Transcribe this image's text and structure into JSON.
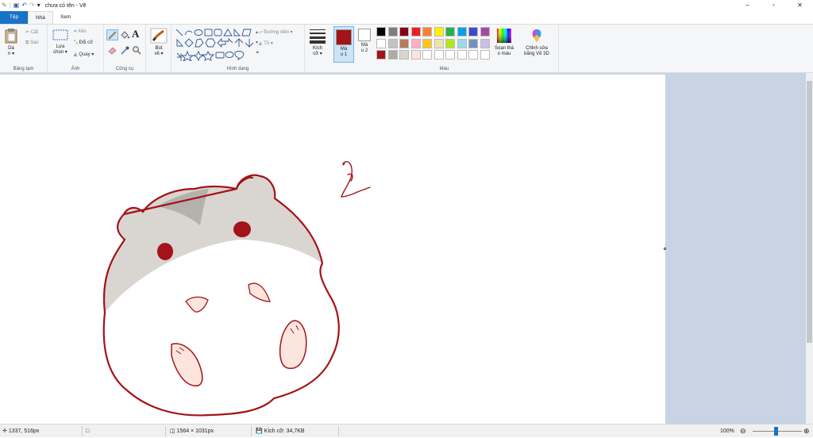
{
  "window": {
    "title": "chưa có tên - Vẽ",
    "buttons": {
      "minimize": "–",
      "maximize": "▫",
      "close": "✕"
    }
  },
  "quick_access": {
    "dropdown": "▾"
  },
  "tabs": [
    {
      "label": "Tệp"
    },
    {
      "label": "Nhà"
    },
    {
      "label": "Xem"
    }
  ],
  "ribbon": {
    "clipboard": {
      "paste_label": "Dá",
      "paste_sub": "n ▾",
      "cut": "Cắt",
      "copy": "Sao",
      "group": "Bảng tạm"
    },
    "image": {
      "select_label": "Lựa",
      "select_sub": "chọn ▾",
      "crop": "Xén",
      "resize": "Đổi cỡ",
      "rotate": "Quay ▾",
      "group": "Ảnh"
    },
    "tools": {
      "group": "Công cụ",
      "text_glyph": "A"
    },
    "brushes": {
      "label": "Bút",
      "sub": "vẽ ▾"
    },
    "shapes": {
      "outline": "Đường viền ▾",
      "fill": "Tô ▾",
      "group": "Hình dạng"
    },
    "size": {
      "label": "Kích",
      "sub": "cỡ ▾"
    },
    "color1": {
      "label": "Mà",
      "sub": "u 1",
      "value": "#a31319"
    },
    "color2": {
      "label": "Mà",
      "sub": "u 2",
      "value": "#ffffff"
    },
    "colors": {
      "group": "Màu",
      "row1": [
        "#000000",
        "#7f7f7f",
        "#880015",
        "#ed1c24",
        "#ff7f27",
        "#fff200",
        "#22b14c",
        "#00a2e8",
        "#3f48cc",
        "#a349a4"
      ],
      "row2": [
        "#ffffff",
        "#c3c3c3",
        "#b97a57",
        "#ffaec9",
        "#ffc90e",
        "#efe4b0",
        "#b5e61d",
        "#99d9ea",
        "#7092be",
        "#c8bfe7"
      ],
      "row3": [
        "#a31319",
        "#aeaaa6",
        "#d9d5d0",
        "#fbe5dc",
        "#ffffff",
        "#ffffff",
        "#ffffff",
        "#ffffff",
        "#ffffff",
        "#ffffff"
      ],
      "edit_label": "Soạn thả",
      "edit_sub": "o màu",
      "paint3d_label": "Chỉnh sửa",
      "paint3d_sub": "bằng Vẽ 3D"
    }
  },
  "drawing": {
    "outline_color": "#a31319",
    "fur_color": "#d9d5d0",
    "shade_color": "#b5b1ac",
    "eye_color": "#a31319",
    "paw_color": "#fbe5dc"
  },
  "status": {
    "cursor": "1337, 516px",
    "dimensions": "1564 × 1031px",
    "filesize": "Kích cỡ: 34,7KB",
    "zoom": "100%",
    "minus": "⊖",
    "plus": "⊕"
  }
}
